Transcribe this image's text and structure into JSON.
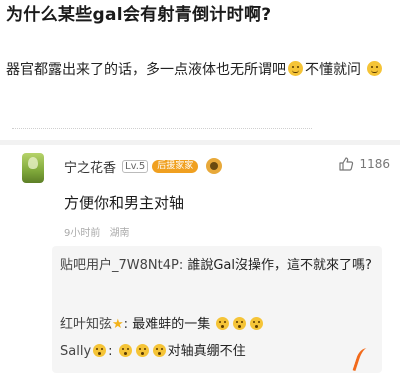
{
  "question": {
    "title": "为什么某些gal会有射青倒计时啊?",
    "body_part1": "器官都露出来了的话，多一点液体也无所谓吧",
    "body_part2": "不懂就问"
  },
  "comment": {
    "username": "宁之花香",
    "level": "Lv.5",
    "badge": "后援家家",
    "like_count": "1186",
    "text": "方便你和男主对轴",
    "time": "9小时前",
    "location": "湖南"
  },
  "replies": [
    {
      "user": "贴吧用户_7W8Nt4P:",
      "content": "誰說Gal沒操作，這不就來了嗎?"
    },
    {
      "user": "红叶知弦",
      "content": "最难蚌的一集"
    },
    {
      "user": "Sally",
      "content": "对轴真绷不住"
    }
  ],
  "colors": {
    "accent": "#f26a1b",
    "badge": "#f0a020"
  },
  "icons": [
    "thumbs-up-icon",
    "emoji-smile-icon",
    "emoji-shock-icon",
    "star-icon"
  ]
}
